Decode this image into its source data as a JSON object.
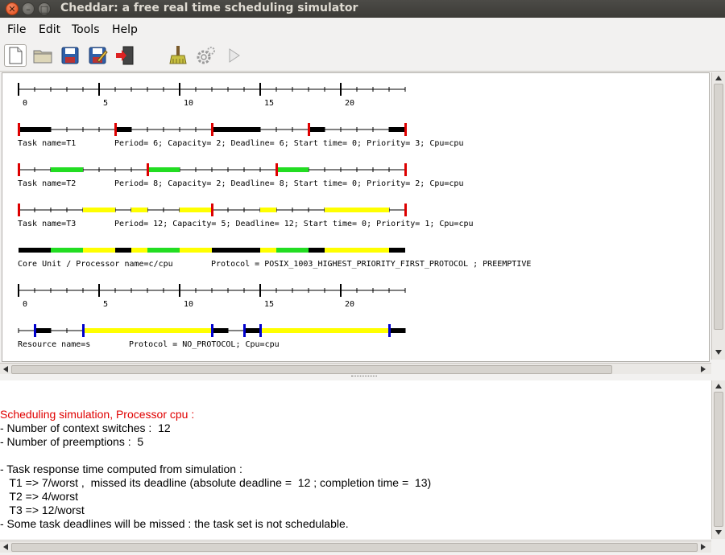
{
  "window": {
    "title": "Cheddar: a free real time scheduling simulator"
  },
  "menu": {
    "items": [
      "File",
      "Edit",
      "Tools",
      "Help"
    ]
  },
  "toolbar": {
    "buttons": [
      "new-file-icon",
      "open-folder-icon",
      "save-icon",
      "save-as-icon",
      "exit-icon",
      "clean-brush-icon",
      "settings-gear-icon",
      "run-play-icon"
    ]
  },
  "colors": {
    "run": "#000000",
    "ready_green": "#22dd22",
    "blocked_yellow": "#ffff00",
    "deadline_red": "#dd0000",
    "resource_blue": "#0000cc",
    "error_text": "#e00000"
  },
  "timeline": {
    "tick_labels": [
      "0",
      "5",
      "10",
      "15",
      "20"
    ],
    "horizon": 24
  },
  "tasks": [
    {
      "label": "Task name=T1",
      "attributes": "Period= 6; Capacity= 2; Deadline= 6; Start time= 0; Priority= 3; Cpu=cpu"
    },
    {
      "label": "Task name=T2",
      "attributes": "Period= 8; Capacity= 2; Deadline= 8; Start time= 0; Priority= 2; Cpu=cpu"
    },
    {
      "label": "Task name=T3",
      "attributes": "Period= 12; Capacity= 5; Deadline= 12; Start time= 0; Priority= 1; Cpu=cpu"
    }
  ],
  "processor": {
    "label": "Core Unit / Processor name=c/cpu",
    "protocol": "Protocol = POSIX_1003_HIGHEST_PRIORITY_FIRST_PROTOCOL ; PREEMPTIVE"
  },
  "resource": {
    "label": "Resource name=s",
    "protocol": "Protocol = NO_PROTOCOL; Cpu=cpu"
  },
  "output": {
    "heading": "Scheduling simulation, Processor cpu :",
    "lines": [
      "- Number of context switches :  12",
      "- Number of preemptions :  5",
      "",
      "- Task response time computed from simulation :",
      "   T1 => 7/worst ,  missed its deadline (absolute deadline =  12 ; completion time =  13)",
      "   T2 => 4/worst",
      "   T3 => 12/worst",
      "- Some task deadlines will be missed : the task set is not schedulable."
    ]
  }
}
